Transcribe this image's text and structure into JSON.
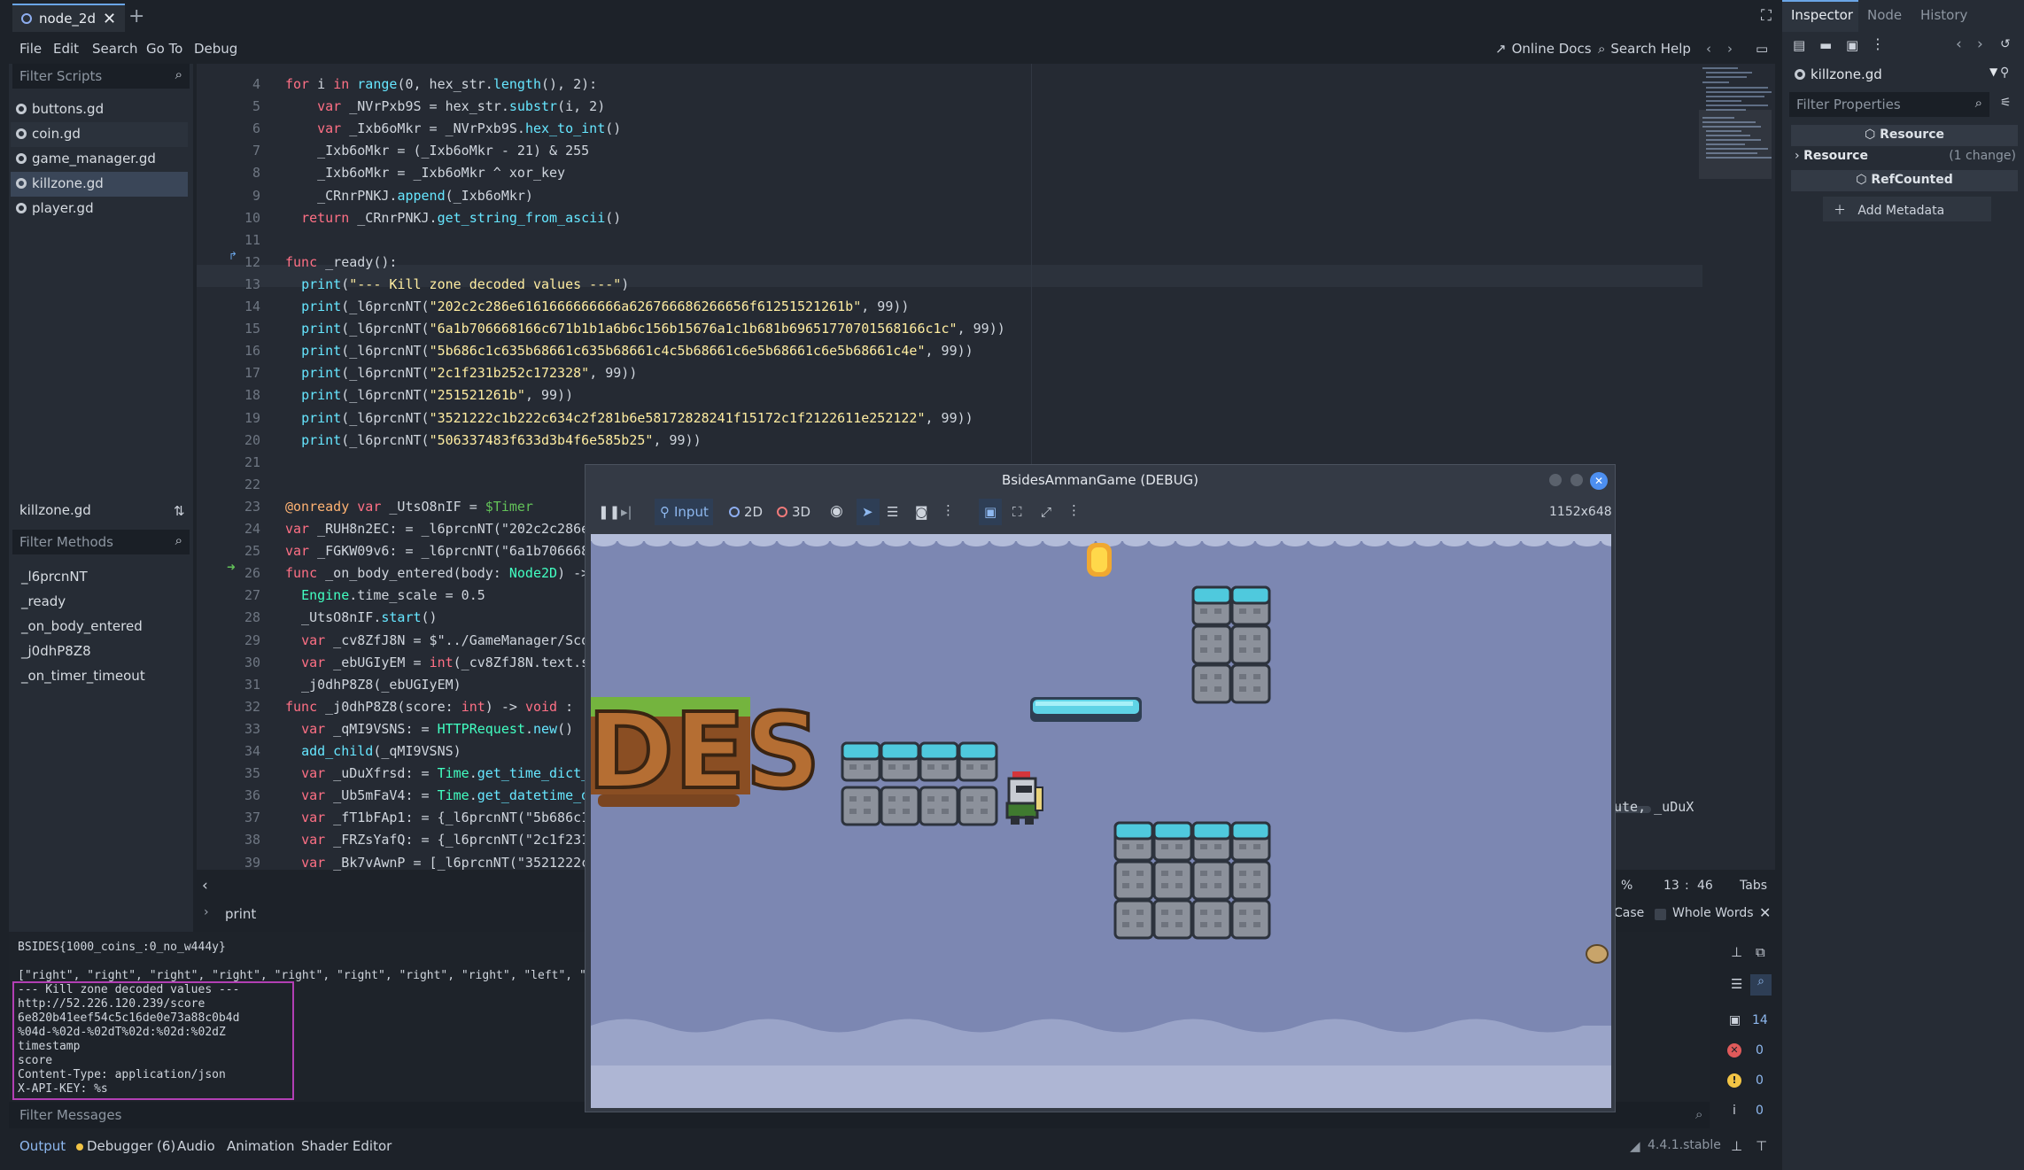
{
  "tab": {
    "title": "node_2d"
  },
  "menus": [
    "File",
    "Edit",
    "Search",
    "Go To",
    "Debug"
  ],
  "help": {
    "online_docs": "Online Docs",
    "search_help": "Search Help"
  },
  "scripts": {
    "filter_placeholder": "Filter Scripts",
    "items": [
      "buttons.gd",
      "coin.gd",
      "game_manager.gd",
      "killzone.gd",
      "player.gd"
    ],
    "selected": "killzone.gd"
  },
  "methods": {
    "current_script": "killzone.gd",
    "filter_placeholder": "Filter Methods",
    "items": [
      "_l6prcnNT",
      "_ready",
      "_on_body_entered",
      "_j0dhP8Z8",
      "_on_timer_timeout"
    ]
  },
  "code": [
    {
      "n": "4",
      "t": "for i in range(0, hex_str.length(), 2):"
    },
    {
      "n": "5",
      "t": "    var _NVrPxb9S = hex_str.substr(i, 2)"
    },
    {
      "n": "6",
      "t": "    var _Ixb6oMkr = _NVrPxb9S.hex_to_int()"
    },
    {
      "n": "7",
      "t": "    _Ixb6oMkr = (_Ixb6oMkr - 21) & 255"
    },
    {
      "n": "8",
      "t": "    _Ixb6oMkr = _Ixb6oMkr ^ xor_key"
    },
    {
      "n": "9",
      "t": "    _CRnrPNKJ.append(_Ixb6oMkr)"
    },
    {
      "n": "10",
      "t": "  return _CRnrPNKJ.get_string_from_ascii()"
    },
    {
      "n": "11",
      "t": ""
    },
    {
      "n": "12",
      "t": "func _ready():"
    },
    {
      "n": "13",
      "t": "  print(\"--- Kill zone decoded values ---\")"
    },
    {
      "n": "14",
      "t": "  print(_l6prcnNT(\"202c2c286e6161666666666a626766686266656f61251521261b\", 99))"
    },
    {
      "n": "15",
      "t": "  print(_l6prcnNT(\"6a1b706668166c671b1b1a6b6c156b15676a1c1b681b69651770701568166c1c\", 99))"
    },
    {
      "n": "16",
      "t": "  print(_l6prcnNT(\"5b686c1c635b68661c635b68661c4c5b68661c6e5b68661c6e5b68661c4e\", 99))"
    },
    {
      "n": "17",
      "t": "  print(_l6prcnNT(\"2c1f231b252c172328\", 99))"
    },
    {
      "n": "18",
      "t": "  print(_l6prcnNT(\"251521261b\", 99))"
    },
    {
      "n": "19",
      "t": "  print(_l6prcnNT(\"3521222c1b222c634c2f281b6e58172828241f15172c1f2122611e252122\", 99))"
    },
    {
      "n": "20",
      "t": "  print(_l6prcnNT(\"506337483f633d3b4f6e585b25\", 99))"
    },
    {
      "n": "21",
      "t": ""
    },
    {
      "n": "22",
      "t": ""
    },
    {
      "n": "23",
      "t": "@onready var _UtsO8nIF = $Timer"
    },
    {
      "n": "24",
      "t": "var _RUH8n2EC: = _l6prcnNT(\"202c2c286e61"
    },
    {
      "n": "25",
      "t": "var _FGKW09v6: = _l6prcnNT(\"6a1b70666816"
    },
    {
      "n": "26",
      "t": "func _on_body_entered(body: Node2D) -> v"
    },
    {
      "n": "27",
      "t": "  Engine.time_scale = 0.5"
    },
    {
      "n": "28",
      "t": "  _UtsO8nIF.start()"
    },
    {
      "n": "29",
      "t": "  var _cv8ZfJ8N = $\"../GameManager/Sco"
    },
    {
      "n": "30",
      "t": "  var _ebUGIyEM = int(_cv8ZfJ8N.text.s"
    },
    {
      "n": "31",
      "t": "  _j0dhP8Z8(_ebUGIyEM)"
    },
    {
      "n": "32",
      "t": "func _j0dhP8Z8(score: int) -> void :"
    },
    {
      "n": "33",
      "t": "  var _qMI9VSNS: = HTTPRequest.new()"
    },
    {
      "n": "34",
      "t": "  add_child(_qMI9VSNS)"
    },
    {
      "n": "35",
      "t": "  var _uDuXfrsd: = Time.get_time_dict_"
    },
    {
      "n": "36",
      "t": "  var _Ub5mFaV4: = Time.get_datetime_d"
    },
    {
      "n": "37",
      "t": "  var _fT1bFAp1: = {_l6prcnNT(\"5b686c1c"
    },
    {
      "n": "38",
      "t": "  var _FRZsYafQ: = {_l6prcnNT(\"2c1f231"
    },
    {
      "n": "39",
      "t": "  var _Bk7vAwnP = [_l6prcnNT(\"3521222c"
    }
  ],
  "code_right_fragment": "ute, _uDuX",
  "status": {
    "zoom": "%",
    "line": "13",
    "col": "46",
    "indent": "Tabs"
  },
  "find": {
    "value": "print",
    "case_label": "Case",
    "whole_words_label": "Whole Words"
  },
  "output": {
    "lines": [
      "BSIDES{1000_coins_:0_no_w444y}",
      "",
      "[\"right\", \"right\", \"right\", \"right\", \"right\", \"right\", \"right\", \"right\", \"left\", \"",
      "--- Kill zone decoded values ---",
      "http://52.226.120.239/score",
      "6e820b41eef54c5c16de0e73a88c0b4d",
      "%04d-%02d-%02dT%02d:%02d:%02dZ",
      "timestamp",
      "score",
      "Content-Type: application/json",
      "X-API-KEY: %s"
    ],
    "filter_placeholder": "Filter Messages",
    "counts": {
      "logs": "14",
      "errors": "0",
      "warnings": "0",
      "info": "0"
    }
  },
  "bottom_tabs": [
    "Output",
    "Debugger (6)",
    "Audio",
    "Animation",
    "Shader Editor"
  ],
  "version": "4.4.1.stable",
  "inspector": {
    "tabs": [
      "Inspector",
      "Node",
      "History"
    ],
    "resource_name": "killzone.gd",
    "filter_placeholder": "Filter Properties",
    "header_resource": "Resource",
    "section_resource": "Resource",
    "section_change": "(1 change)",
    "header_refcounted": "RefCounted",
    "add_metadata": "Add Metadata"
  },
  "game": {
    "title": "BsidesAmmanGame (DEBUG)",
    "toolbar": {
      "input": "Input",
      "two_d": "2D",
      "three_d": "3D"
    },
    "resolution": "1152x648",
    "logo_text": "DES"
  },
  "colors": {
    "accent": "#6aa5e6",
    "highlight_box": "#b23fb4",
    "keyword": "#ff7085",
    "string": "#ffeda1",
    "function": "#66e6ff"
  }
}
